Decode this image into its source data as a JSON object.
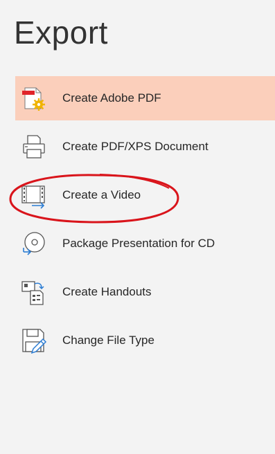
{
  "page": {
    "title": "Export"
  },
  "menu": {
    "items": [
      {
        "label": "Create Adobe PDF",
        "icon": "adobe-pdf-icon",
        "selected": true
      },
      {
        "label": "Create PDF/XPS Document",
        "icon": "pdf-xps-document-icon",
        "selected": false
      },
      {
        "label": "Create a Video",
        "icon": "video-icon",
        "selected": false
      },
      {
        "label": "Package Presentation for CD",
        "icon": "cd-package-icon",
        "selected": false
      },
      {
        "label": "Create Handouts",
        "icon": "handouts-icon",
        "selected": false
      },
      {
        "label": "Change File Type",
        "icon": "change-file-type-icon",
        "selected": false
      }
    ]
  },
  "colors": {
    "selected_background": "#fbcfbb",
    "annotation": "#d9141b",
    "accent_blue": "#2b7cd3"
  }
}
